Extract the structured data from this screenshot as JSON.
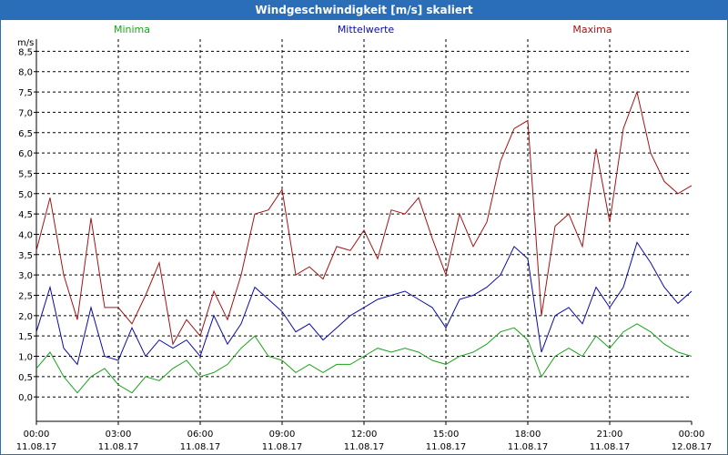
{
  "window": {
    "title": "Windgeschwindigkeit [m/s] skaliert"
  },
  "legend": {
    "min_label": "Minima",
    "mean_label": "Mittelwerte",
    "max_label": "Maxima"
  },
  "colors": {
    "minima": "#1aa31a",
    "mean": "#0a0aa8",
    "maxima": "#a31414",
    "title_bar": "#2a6db8"
  },
  "chart_data": {
    "type": "line",
    "title": "Windgeschwindigkeit [m/s] skaliert",
    "ylabel": "m/s",
    "ylim": [
      -0.6,
      8.8
    ],
    "yticks": [
      "0,0",
      "0,5",
      "1,0",
      "1,5",
      "2,0",
      "2,5",
      "3,0",
      "3,5",
      "4,0",
      "4,5",
      "5,0",
      "5,5",
      "6,0",
      "6,5",
      "7,0",
      "7,5",
      "8,0",
      "8,5"
    ],
    "xlim_hours": [
      0,
      24
    ],
    "xticks": [
      {
        "time": "00:00",
        "date": "11.08.17"
      },
      {
        "time": "03:00",
        "date": "11.08.17"
      },
      {
        "time": "06:00",
        "date": "11.08.17"
      },
      {
        "time": "09:00",
        "date": "11.08.17"
      },
      {
        "time": "12:00",
        "date": "11.08.17"
      },
      {
        "time": "15:00",
        "date": "11.08.17"
      },
      {
        "time": "18:00",
        "date": "11.08.17"
      },
      {
        "time": "21:00",
        "date": "11.08.17"
      },
      {
        "time": "00:00",
        "date": "12.08.17"
      }
    ],
    "grid": true,
    "legend_position": "top",
    "x_hours": [
      0,
      0.5,
      1,
      1.5,
      2,
      2.5,
      3,
      3.5,
      4,
      4.5,
      5,
      5.5,
      6,
      6.5,
      7,
      7.5,
      8,
      8.5,
      9,
      9.5,
      10,
      10.5,
      11,
      11.5,
      12,
      12.5,
      13,
      13.5,
      14,
      14.5,
      15,
      15.5,
      16,
      16.5,
      17,
      17.5,
      18,
      18.5,
      19,
      19.5,
      20,
      20.5,
      21,
      21.5,
      22,
      22.5,
      23,
      23.5,
      24
    ],
    "series": [
      {
        "name": "Maxima",
        "values": [
          3.6,
          4.9,
          3.0,
          1.9,
          4.4,
          2.2,
          2.2,
          1.8,
          2.5,
          3.3,
          1.3,
          1.9,
          1.5,
          2.6,
          1.9,
          3.0,
          4.5,
          4.6,
          5.1,
          3.0,
          3.2,
          2.9,
          3.7,
          3.6,
          4.1,
          3.4,
          4.6,
          4.5,
          4.9,
          3.9,
          3.0,
          4.5,
          3.7,
          4.3,
          5.8,
          6.6,
          6.8,
          2.0,
          4.2,
          4.5,
          3.7,
          6.1,
          4.3,
          6.6,
          7.5,
          6.0,
          5.3,
          5.0,
          5.2
        ]
      },
      {
        "name": "Mittelwerte",
        "values": [
          1.6,
          2.7,
          1.2,
          0.8,
          2.2,
          1.0,
          0.9,
          1.7,
          1.0,
          1.4,
          1.2,
          1.4,
          1.0,
          2.0,
          1.3,
          1.8,
          2.7,
          2.4,
          2.1,
          1.6,
          1.8,
          1.4,
          1.7,
          2.0,
          2.2,
          2.4,
          2.5,
          2.6,
          2.4,
          2.2,
          1.7,
          2.4,
          2.5,
          2.7,
          3.0,
          3.7,
          3.4,
          1.1,
          2.0,
          2.2,
          1.8,
          2.7,
          2.2,
          2.7,
          3.8,
          3.3,
          2.7,
          2.3,
          2.6
        ]
      },
      {
        "name": "Minima",
        "values": [
          0.7,
          1.1,
          0.5,
          0.1,
          0.5,
          0.7,
          0.3,
          0.1,
          0.5,
          0.4,
          0.7,
          0.9,
          0.5,
          0.6,
          0.8,
          1.2,
          1.5,
          1.0,
          0.9,
          0.6,
          0.8,
          0.6,
          0.8,
          0.8,
          1.0,
          1.2,
          1.1,
          1.2,
          1.1,
          0.9,
          0.8,
          1.0,
          1.1,
          1.3,
          1.6,
          1.7,
          1.4,
          0.5,
          1.0,
          1.2,
          1.0,
          1.5,
          1.2,
          1.6,
          1.8,
          1.6,
          1.3,
          1.1,
          1.0
        ]
      }
    ]
  }
}
